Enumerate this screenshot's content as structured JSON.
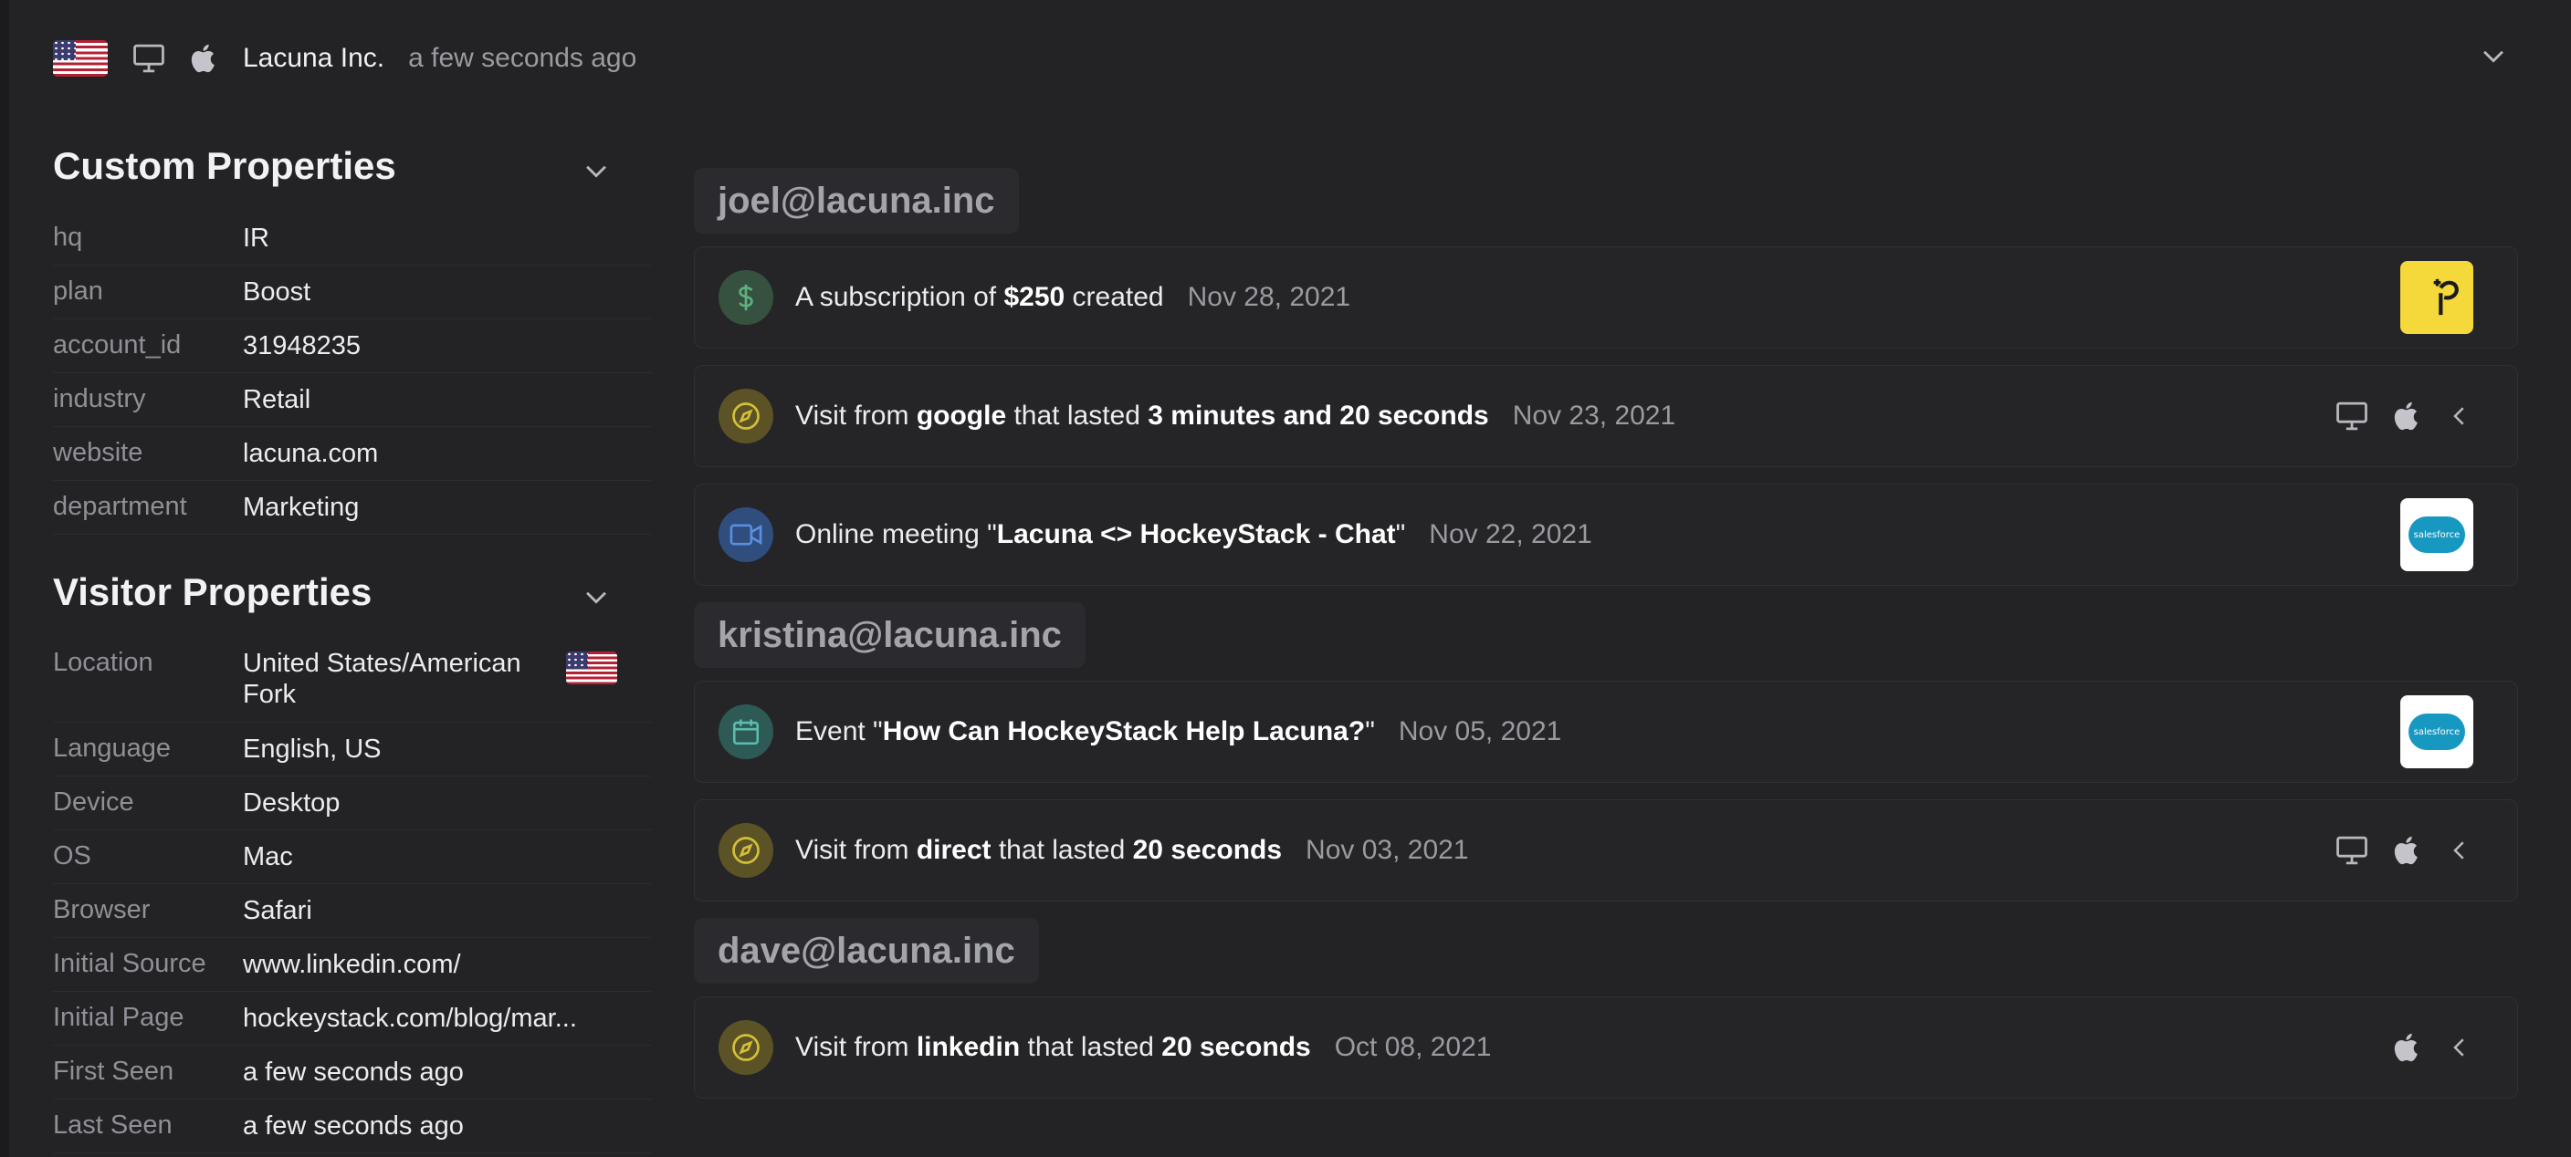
{
  "header": {
    "company": "Lacuna Inc.",
    "last_seen": "a few seconds ago"
  },
  "custom_properties": {
    "title": "Custom Properties",
    "rows": [
      {
        "key": "hq",
        "value": "IR"
      },
      {
        "key": "plan",
        "value": "Boost"
      },
      {
        "key": "account_id",
        "value": "31948235"
      },
      {
        "key": "industry",
        "value": "Retail"
      },
      {
        "key": "website",
        "value": "lacuna.com"
      },
      {
        "key": "department",
        "value": "Marketing"
      }
    ]
  },
  "visitor_properties": {
    "title": "Visitor Properties",
    "rows": [
      {
        "key": "Location",
        "value": "United States/American Fork"
      },
      {
        "key": "Language",
        "value": "English, US"
      },
      {
        "key": "Device",
        "value": "Desktop"
      },
      {
        "key": "OS",
        "value": "Mac"
      },
      {
        "key": "Browser",
        "value": "Safari"
      },
      {
        "key": "Initial Source",
        "value": "www.linkedin.com/"
      },
      {
        "key": "Initial Page",
        "value": "hockeystack.com/blog/mar..."
      },
      {
        "key": "First Seen",
        "value": "a few seconds ago"
      },
      {
        "key": "Last Seen",
        "value": "a few seconds ago"
      }
    ]
  },
  "timeline": [
    {
      "email": "joel@lacuna.inc",
      "events": [
        {
          "icon": "dollar-icon",
          "parts": [
            "A subscription of ",
            "$250",
            " created"
          ],
          "date": "Nov 28, 2021",
          "source": "paddle-logo"
        },
        {
          "icon": "compass-icon",
          "parts": [
            "Visit from ",
            "google",
            " that lasted ",
            "3 minutes and 20 seconds"
          ],
          "date": "Nov 23, 2021",
          "device_icons": [
            "desktop-icon",
            "apple-icon",
            "chevron-left-icon"
          ]
        },
        {
          "icon": "video-icon",
          "parts": [
            "Online meeting \"",
            "Lacuna <> HockeyStack - Chat",
            "\""
          ],
          "date": "Nov 22, 2021",
          "source": "salesforce-logo",
          "source_label": "salesforce"
        }
      ]
    },
    {
      "email": "kristina@lacuna.inc",
      "events": [
        {
          "icon": "calendar-icon",
          "parts": [
            "Event \"",
            "How Can HockeyStack Help Lacuna?",
            "\""
          ],
          "date": "Nov 05, 2021",
          "source": "salesforce-logo",
          "source_label": "salesforce"
        },
        {
          "icon": "compass-icon",
          "parts": [
            "Visit from ",
            "direct",
            " that lasted ",
            "20 seconds"
          ],
          "date": "Nov 03, 2021",
          "device_icons": [
            "desktop-icon",
            "apple-icon",
            "chevron-left-icon"
          ]
        }
      ]
    },
    {
      "email": "dave@lacuna.inc",
      "events": [
        {
          "icon": "compass-icon",
          "parts": [
            "Visit from ",
            "linkedin",
            " that lasted ",
            "20 seconds"
          ],
          "date": "Oct 08, 2021",
          "device_icons": [
            "apple-icon",
            "chevron-left-icon"
          ]
        }
      ]
    }
  ],
  "colors": {
    "background": "#232326",
    "dollar": "#4e8f6a",
    "compass": "#b8a532",
    "video": "#3f6fb8",
    "calendar": "#3f8f86",
    "paddle": "#f5d83a",
    "salesforce": "#1798c1"
  }
}
